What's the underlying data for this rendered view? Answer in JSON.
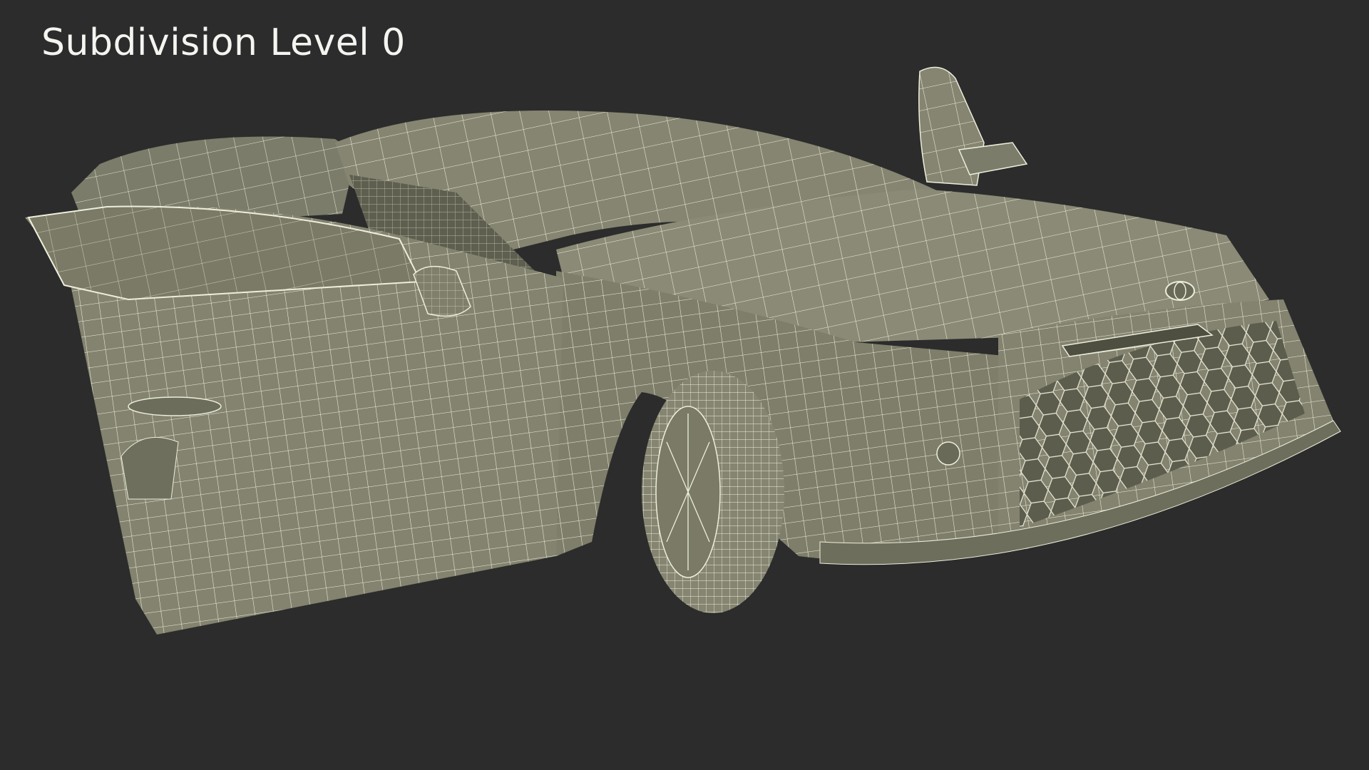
{
  "viewport": {
    "label": "Subdivision Level 0"
  },
  "colors": {
    "background": "#2c2c2c",
    "surface": "#858572",
    "surface_dark": "#6b6b5a",
    "wire": "#eeeedc",
    "label": "#f4f4f0"
  }
}
